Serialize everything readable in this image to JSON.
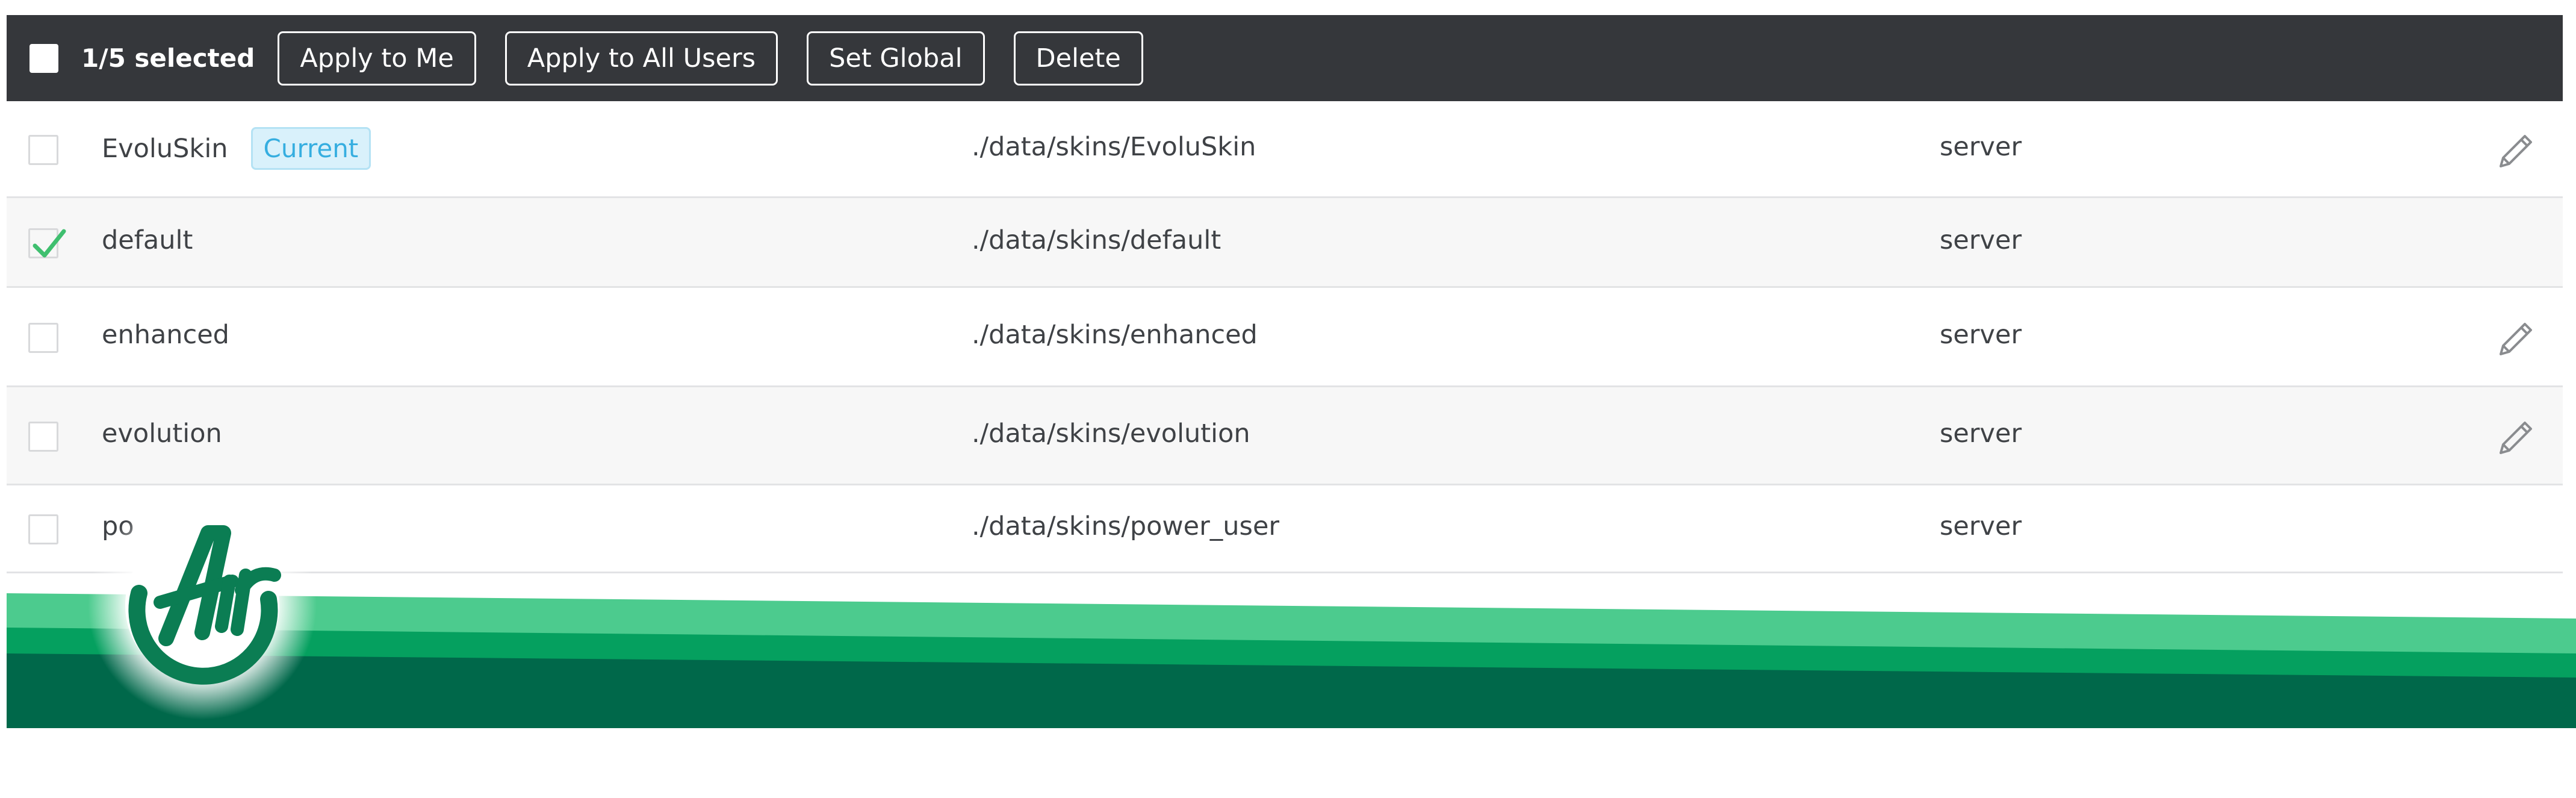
{
  "toolbar": {
    "selected_label": "1/5 selected",
    "buttons": [
      {
        "label": "Apply to Me"
      },
      {
        "label": "Apply to All Users"
      },
      {
        "label": "Set Global"
      },
      {
        "label": "Delete"
      }
    ]
  },
  "skins": {
    "current_badge": "Current",
    "rows": [
      {
        "name": "EvoluSkin",
        "path": "./data/skins/EvoluSkin",
        "location": "server",
        "checked": false,
        "current": true,
        "editable": true
      },
      {
        "name": "default",
        "path": "./data/skins/default",
        "location": "server",
        "checked": true,
        "current": false,
        "editable": false
      },
      {
        "name": "enhanced",
        "path": "./data/skins/enhanced",
        "location": "server",
        "checked": false,
        "current": false,
        "editable": true
      },
      {
        "name": "evolution",
        "path": "./data/skins/evolution",
        "location": "server",
        "checked": false,
        "current": false,
        "editable": true
      },
      {
        "name": "po",
        "path": "./data/skins/power_user",
        "location": "server",
        "checked": false,
        "current": false,
        "editable": false
      }
    ]
  },
  "logo": {
    "text": "Air",
    "icon": "air-logo"
  },
  "colors": {
    "toolbar_bg": "#35373b",
    "check_green": "#3fbf6f",
    "badge_text": "#36aee0",
    "band_light": "#4ccb8e",
    "band_mid": "#05a05f",
    "band_dark": "#00684a"
  }
}
